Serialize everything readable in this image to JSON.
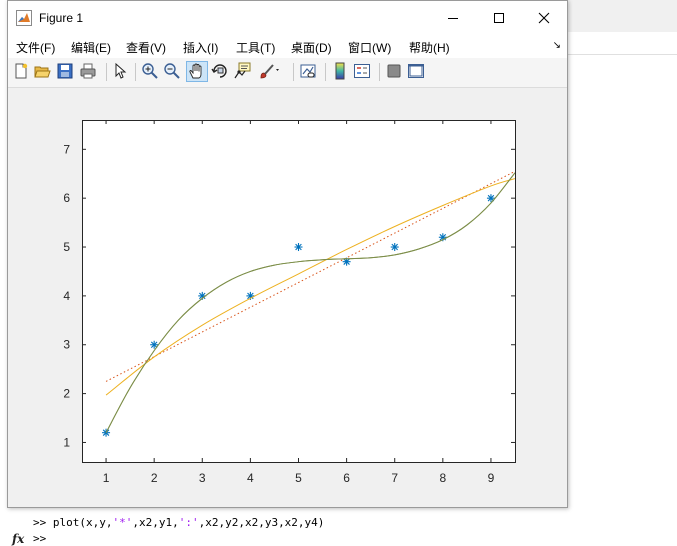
{
  "figure_window": {
    "title": "Figure 1",
    "menu": [
      "文件(F)",
      "编辑(E)",
      "查看(V)",
      "插入(I)",
      "工具(T)",
      "桌面(D)",
      "窗口(W)",
      "帮助(H)"
    ],
    "menu_overflow": "↘",
    "toolbar_icons": [
      "new-figure-icon",
      "open-icon",
      "save-icon",
      "print-icon",
      "pointer-icon",
      "zoom-in-icon",
      "zoom-out-icon",
      "pan-icon",
      "rotate-3d-icon",
      "data-cursor-icon",
      "brush-icon",
      "link-plot-icon",
      "colorbar-icon",
      "legend-icon",
      "hide-plot-tools-icon",
      "show-plot-tools-icon"
    ],
    "active_tool": "pan-icon"
  },
  "command_window": {
    "prompt": ">>",
    "cmd_pre": " plot(x,y,",
    "str1": "'*'",
    "cmd_mid": ",x2,y1,",
    "str2": "':'",
    "cmd_post": ",x2,y2,x2,y3,x2,y4)",
    "fx_label": "fx"
  },
  "chart_data": {
    "type": "line",
    "xlim": [
      0.5,
      9.5
    ],
    "ylim": [
      0.6,
      7.6
    ],
    "xticks": [
      1,
      2,
      3,
      4,
      5,
      6,
      7,
      8,
      9
    ],
    "yticks": [
      1,
      2,
      3,
      4,
      5,
      6,
      7
    ],
    "grid": false,
    "series": [
      {
        "style": "markers-asterisk",
        "color": "#0072bd",
        "x": [
          1,
          2,
          3,
          4,
          5,
          6,
          7,
          8,
          9
        ],
        "y": [
          1.2,
          3,
          4,
          4,
          5,
          4.7,
          5,
          5.2,
          6
        ]
      },
      {
        "style": "dotted",
        "color": "#d95319",
        "x": [
          1,
          9.5
        ],
        "y": [
          2.25,
          6.55
        ]
      },
      {
        "style": "solid",
        "color": "#edb120",
        "x": [
          1,
          2,
          3,
          4,
          5,
          6,
          7,
          8,
          9,
          9.5
        ],
        "y": [
          1.97,
          2.75,
          3.4,
          3.95,
          4.45,
          4.95,
          5.42,
          5.85,
          6.25,
          6.4
        ]
      },
      {
        "style": "solid",
        "color": "#77ac30",
        "x": [
          1,
          1.5,
          2,
          2.5,
          3,
          3.5,
          4,
          4.5,
          5,
          5.5,
          6,
          6.5,
          7,
          7.5,
          8,
          8.5,
          9,
          9.5
        ],
        "y": [
          1.2,
          2.12,
          2.88,
          3.5,
          3.95,
          4.28,
          4.5,
          4.63,
          4.7,
          4.74,
          4.76,
          4.78,
          4.84,
          4.96,
          5.15,
          5.45,
          5.9,
          6.52
        ]
      },
      {
        "style": "solid",
        "color": "#7e8a4d",
        "x": [
          1,
          1.5,
          2,
          2.5,
          3,
          3.5,
          4,
          4.5,
          5,
          5.5,
          6,
          6.5,
          7,
          7.5,
          8,
          8.5,
          9,
          9.5
        ],
        "y": [
          1.2,
          2.12,
          2.88,
          3.5,
          3.95,
          4.28,
          4.5,
          4.63,
          4.7,
          4.74,
          4.76,
          4.78,
          4.84,
          4.96,
          5.15,
          5.45,
          5.9,
          6.52
        ]
      }
    ]
  }
}
